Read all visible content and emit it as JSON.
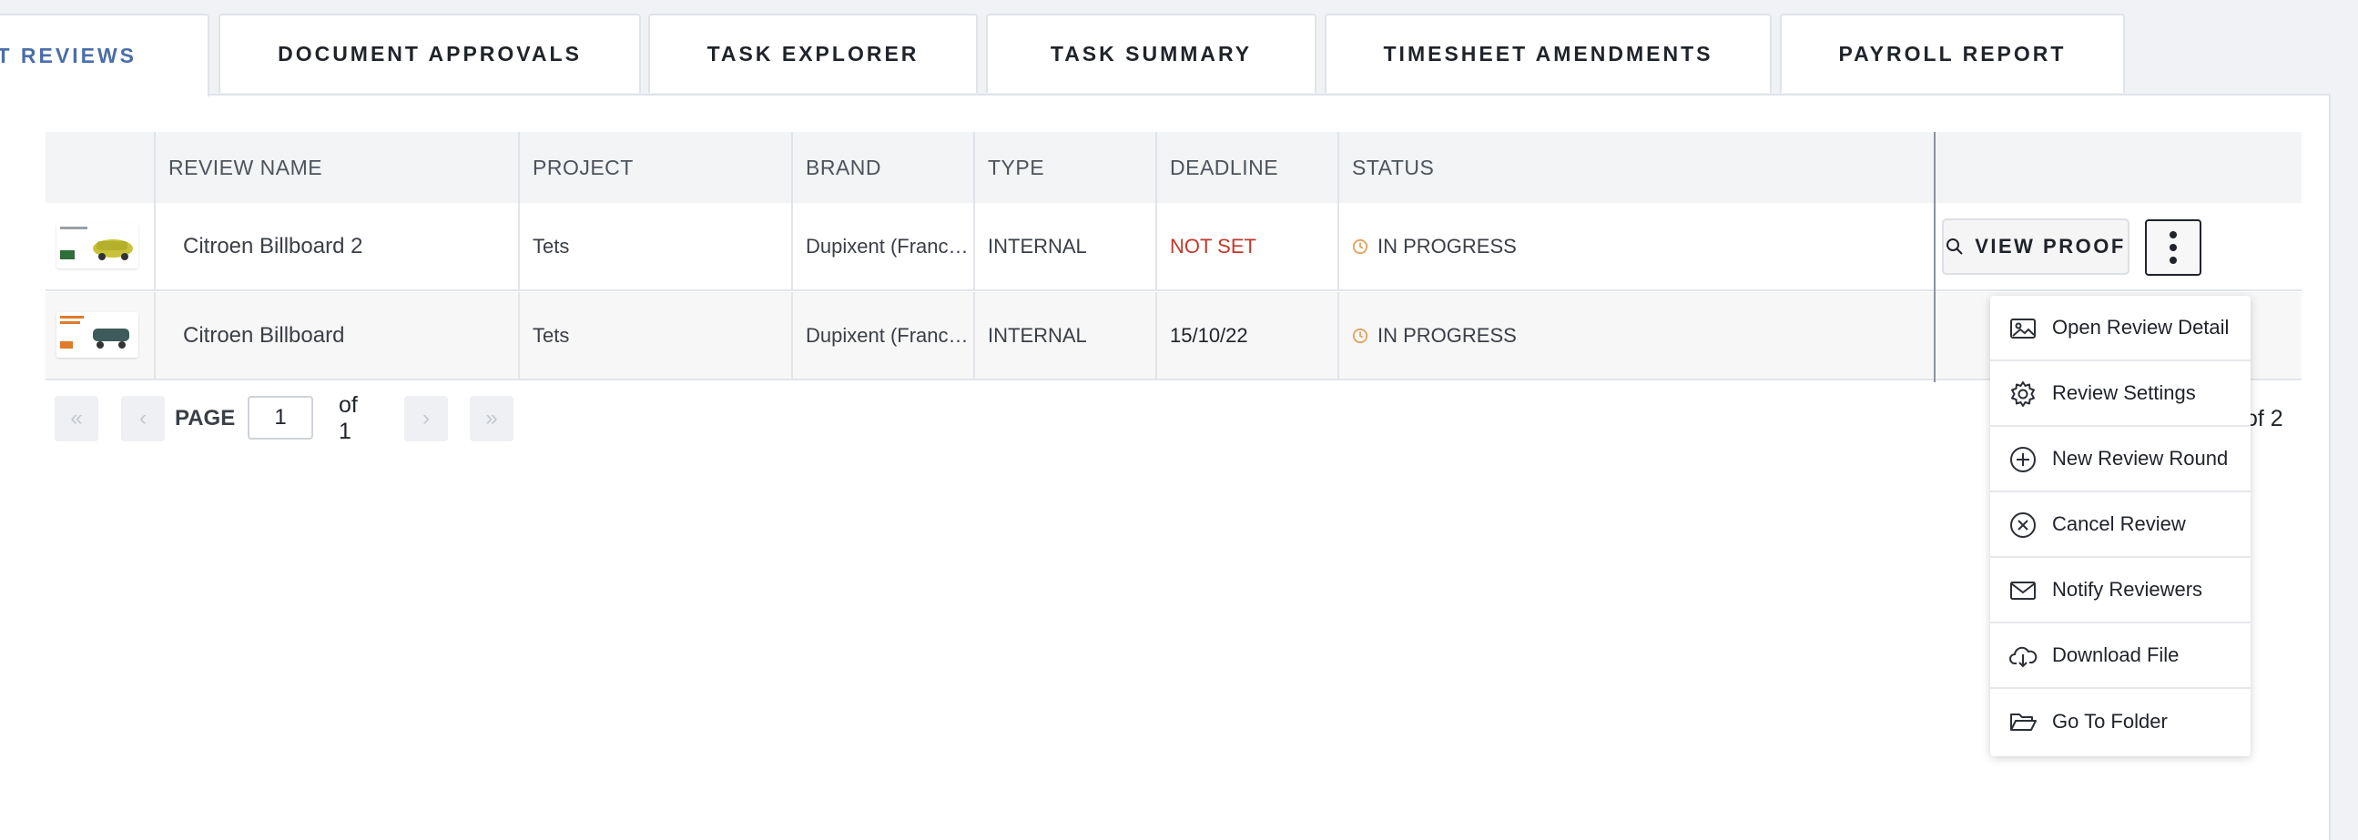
{
  "tabs": [
    {
      "label": "NT REVIEWS",
      "active": true
    },
    {
      "label": "DOCUMENT APPROVALS"
    },
    {
      "label": "TASK EXPLORER"
    },
    {
      "label": "TASK SUMMARY"
    },
    {
      "label": "TIMESHEET AMENDMENTS"
    },
    {
      "label": "PAYROLL REPORT"
    }
  ],
  "table": {
    "headers": [
      "REVIEW NAME",
      "PROJECT",
      "BRAND",
      "TYPE",
      "DEADLINE",
      "STATUS"
    ],
    "rows": [
      {
        "name": "Citroen Billboard 2",
        "project": "Tets",
        "brand": "Dupixent (Franc…",
        "type": "INTERNAL",
        "deadline": "NOT SET",
        "status": "IN PROGRESS"
      },
      {
        "name": "Citroen Billboard",
        "project": "Tets",
        "brand": "Dupixent (Franc…",
        "type": "INTERNAL",
        "deadline": "15/10/22",
        "status": "IN PROGRESS"
      }
    ]
  },
  "actions": {
    "view_proof": "VIEW PROOF"
  },
  "pagination": {
    "page_label": "PAGE",
    "page_value": "1",
    "of_text": "of 1",
    "right_text": "of 2"
  },
  "menu": [
    {
      "label": "Open Review Detail",
      "icon": "image-icon"
    },
    {
      "label": "Review Settings",
      "icon": "gear-icon"
    },
    {
      "label": "New Review Round",
      "icon": "plus-circle-icon"
    },
    {
      "label": "Cancel Review",
      "icon": "x-circle-icon"
    },
    {
      "label": "Notify Reviewers",
      "icon": "envelope-icon"
    },
    {
      "label": "Download File",
      "icon": "cloud-download-icon"
    },
    {
      "label": "Go To Folder",
      "icon": "folder-open-icon"
    }
  ],
  "colors": {
    "active_tab": "#4a6ea9",
    "deadline_not_set": "#c0392b",
    "status_icon": "#e2a15c"
  }
}
